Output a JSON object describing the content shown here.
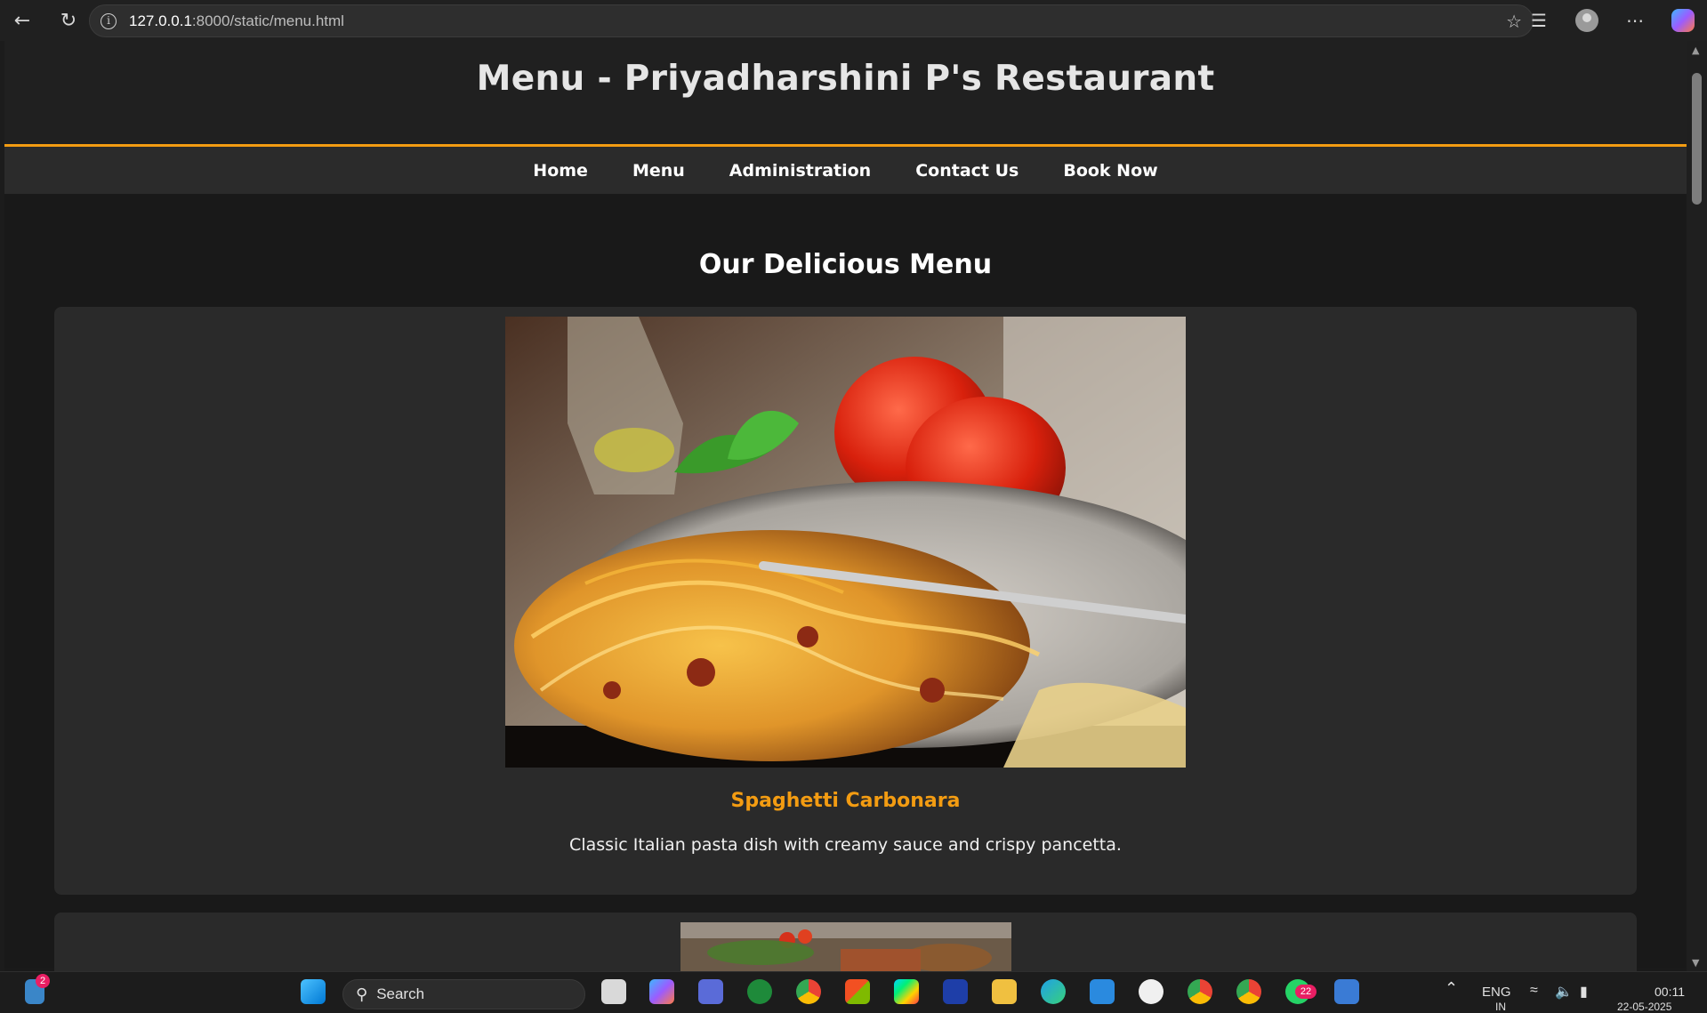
{
  "browser": {
    "url_host": "127.0.0.1",
    "url_path": ":8000/static/menu.html"
  },
  "site": {
    "title": "Menu - Priyadharshini P's Restaurant",
    "nav": [
      "Home",
      "Menu",
      "Administration",
      "Contact Us",
      "Book Now"
    ],
    "section_title": "Our Delicious Menu"
  },
  "menu_items": [
    {
      "name": "Spaghetti Carbonara",
      "description": "Classic Italian pasta dish with creamy sauce and crispy pancetta."
    }
  ],
  "taskbar": {
    "search_label": "Search",
    "notification_count": "2",
    "whatsapp_count": "22",
    "language": "ENG",
    "language_region": "IN",
    "time": "00:11",
    "date": "22-05-2025"
  },
  "colors": {
    "accent": "#f39c12",
    "header_bg": "#202020",
    "nav_bg": "#2b2b2b",
    "card_bg": "#2a2a2a"
  }
}
